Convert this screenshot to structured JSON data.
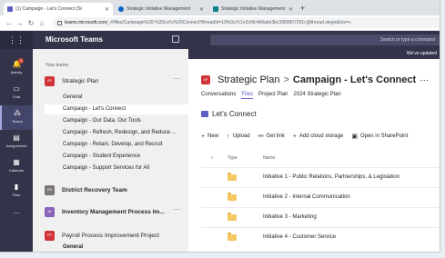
{
  "browser": {
    "tabs": [
      {
        "label": "(1) Campaign - Let's Connect (St",
        "active": true
      },
      {
        "label": "Strategic Initiative Managemént",
        "active": false
      },
      {
        "label": "Strategic Initiative Management",
        "active": false
      }
    ],
    "new_tab": "+",
    "url_host": "teams.microsoft.com",
    "url_path": "/_#/files/Campaign%20-%20Let's%20Connect?threadId=19%3a7c1e2c6fc4b9abe3bc3983507201c@thread.skype&ctx=c"
  },
  "teams": {
    "app_name": "Microsoft Teams",
    "search_placeholder": "Search or type a command",
    "banner": "We've updated",
    "rail": [
      {
        "label": "Activity",
        "icon": "bell-icon",
        "badge": "1"
      },
      {
        "label": "Chat",
        "icon": "chat-icon"
      },
      {
        "label": "Teams",
        "icon": "teams-icon",
        "active": true
      },
      {
        "label": "Assignments",
        "icon": "assignments-icon"
      },
      {
        "label": "Calendar",
        "icon": "calendar-icon"
      },
      {
        "label": "Files",
        "icon": "files-icon"
      },
      {
        "label": "...",
        "icon": "more-apps-icon"
      }
    ],
    "your_teams_label": "Your teams",
    "team_list": {
      "strategic_plan": {
        "name": "Strategic Plan",
        "avatar": "SP",
        "color": "#d13438"
      },
      "channels": [
        "General",
        "Campaign - Let's Connect",
        "Campaign - Our Data, Our Tools",
        "Campaign - Refresh, Redesign, and Reduce ...",
        "Campaign - Retain, Develop, and Recruit",
        "Campaign - Student Experience",
        "Campaign - Support Services for All"
      ],
      "district_recovery": {
        "name": "District Recovery Team",
        "avatar": "DR",
        "color": "#7a7574"
      },
      "inventory": {
        "name": "Inventory Management Process Im...",
        "avatar": "IM",
        "color": "#8764b8"
      },
      "payroll": {
        "name": "Payroll Process Improvement Project",
        "avatar": "PP",
        "color": "#d13438"
      },
      "payroll_general": "General"
    },
    "main": {
      "team": "Strategic Plan",
      "separator": ">",
      "channel": "Campaign - Let's Connect",
      "more": "···",
      "tabs": [
        "Conversations",
        "Files",
        "Project Plan",
        "2024 Strategic Plan"
      ],
      "files_title": "Let's Connect",
      "commands": [
        {
          "icon": "+",
          "label": "New"
        },
        {
          "icon": "↑",
          "label": "Upload"
        },
        {
          "icon": "⚯",
          "label": "Get link"
        },
        {
          "icon": "+",
          "label": "Add cloud storage"
        },
        {
          "icon": "▣",
          "label": "Open in SharePoint"
        }
      ],
      "columns": {
        "type": "Type",
        "name": "Name"
      },
      "folders": [
        "Initiative 1 - Public Relations, Partnerships, & Legislation",
        "Initiative 2 - Internal Communication",
        "Initiative 3 - Marketing",
        "Initiative 4 - Customer Service"
      ]
    }
  }
}
